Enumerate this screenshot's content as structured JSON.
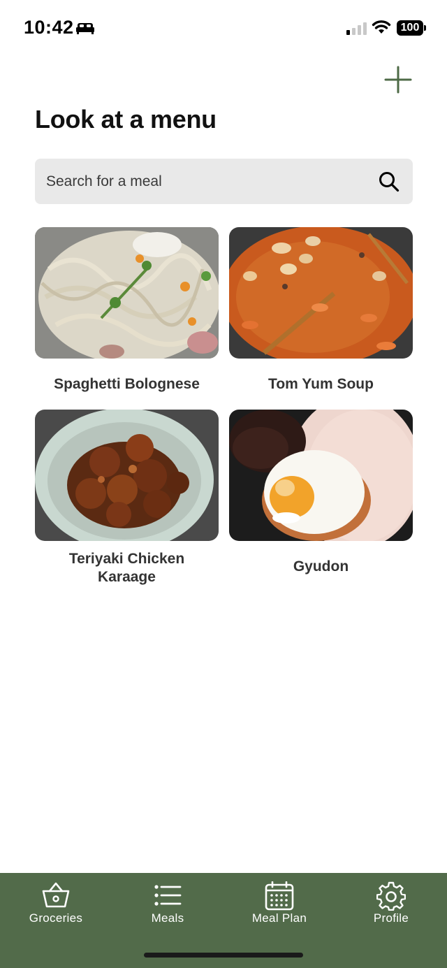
{
  "status_bar": {
    "time": "10:42",
    "battery": "100",
    "icons": [
      "sleep-mode-icon",
      "signal-icon",
      "wifi-icon",
      "battery-icon"
    ]
  },
  "header": {
    "title": "Look at a menu",
    "add_icon": "plus-icon"
  },
  "search": {
    "placeholder": "Search for a meal",
    "value": "",
    "icon": "search-icon"
  },
  "meals": [
    {
      "name": "Spaghetti Bolognese",
      "image": "creamy-spaghetti-photo"
    },
    {
      "name": "Tom Yum Soup",
      "image": "orange-soup-photo"
    },
    {
      "name": "Teriyaki Chicken Karaage",
      "image": "glazed-chicken-bowl-photo"
    },
    {
      "name": "Gyudon",
      "image": "rice-fried-egg-photo"
    }
  ],
  "tab_bar": {
    "items": [
      {
        "label": "Groceries",
        "icon": "basket-icon"
      },
      {
        "label": "Meals",
        "icon": "list-icon"
      },
      {
        "label": "Meal Plan",
        "icon": "calendar-icon"
      },
      {
        "label": "Profile",
        "icon": "gear-icon"
      }
    ]
  },
  "colors": {
    "accent": "#526b4a",
    "search_bg": "#e9e9e9",
    "title_text": "#111111",
    "card_text": "#333333"
  }
}
